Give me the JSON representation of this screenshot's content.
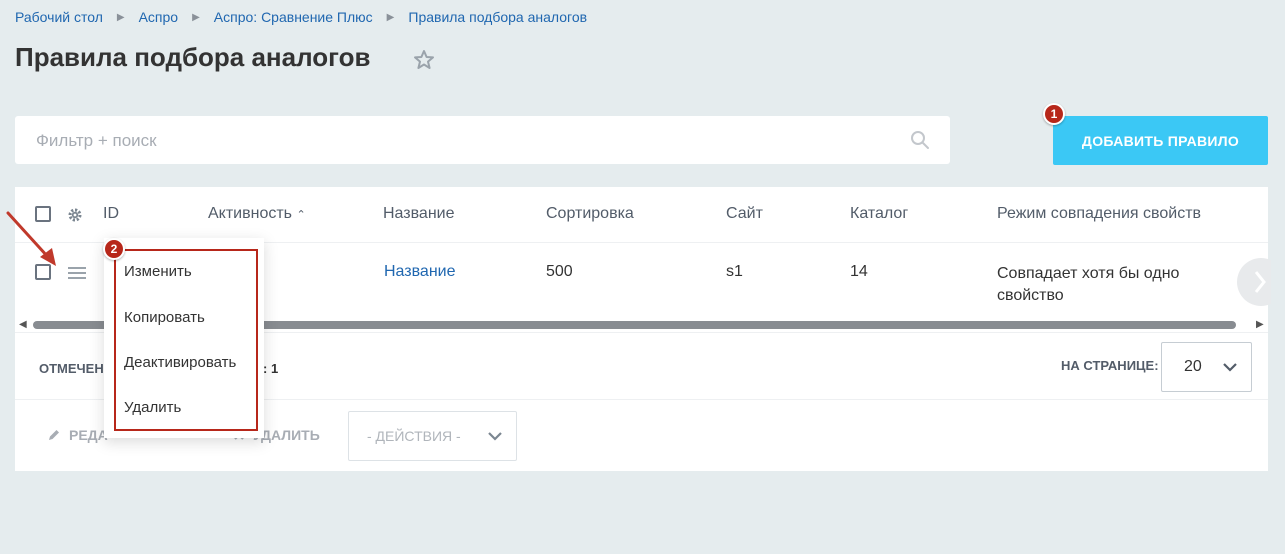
{
  "breadcrumbs": [
    "Рабочий стол",
    "Аспро",
    "Аспро: Сравнение Плюс",
    "Правила подбора аналогов"
  ],
  "page": {
    "title": "Правила подбора аналогов"
  },
  "filter": {
    "placeholder": "Фильтр + поиск"
  },
  "toolbar": {
    "add_label": "ДОБАВИТЬ ПРАВИЛО"
  },
  "markers": {
    "m1": "1",
    "m2": "2"
  },
  "table": {
    "columns": [
      "ID",
      "Активность",
      "Название",
      "Сортировка",
      "Сайт",
      "Каталог",
      "Режим совпадения свойств"
    ],
    "rows": [
      {
        "id": "",
        "active": "",
        "name": "Название",
        "sort": "500",
        "site": "s1",
        "catalog": "14",
        "mode": "Совпадает хотя бы одно свойство"
      }
    ]
  },
  "context_menu": {
    "items": [
      "Изменить",
      "Копировать",
      "Деактивировать",
      "Удалить"
    ]
  },
  "footer": {
    "marked_label": "ОТМЕЧЕН",
    "marked_count": ": 1",
    "per_page_label": "НА СТРАНИЦЕ:",
    "per_page_value": "20",
    "edit_label": "РЕДА",
    "delete_label": "УДАЛИТЬ",
    "actions_placeholder": "- ДЕЙСТВИЯ -"
  },
  "colors": {
    "accent": "#3bc8f5",
    "marker": "#b7271a",
    "link": "#2067b0",
    "background": "#e5ecee"
  }
}
